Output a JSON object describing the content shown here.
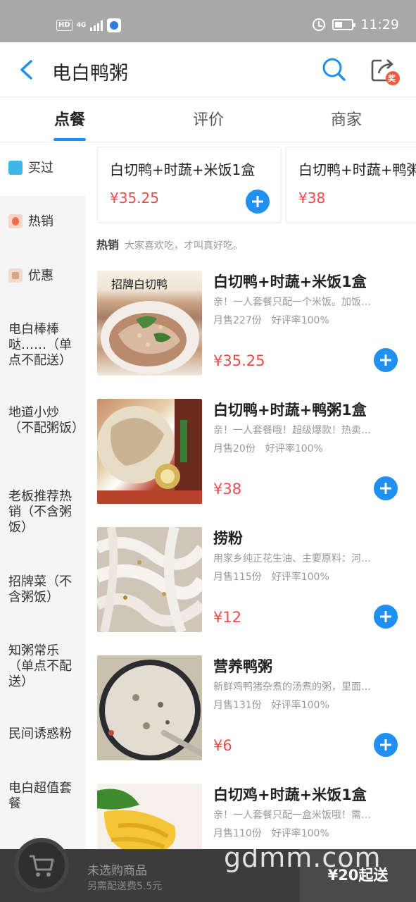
{
  "status_bar": {
    "hd": "HD",
    "network": "4G",
    "time": "11:29"
  },
  "header": {
    "title": "电白鸭粥",
    "back_icon": "chevron-left-icon",
    "search_icon": "search-icon",
    "share_icon": "share-icon",
    "share_badge": "奖"
  },
  "tabs": [
    {
      "label": "点餐"
    },
    {
      "label": "评价"
    },
    {
      "label": "商家"
    }
  ],
  "sidebar": {
    "items": [
      {
        "label": "买过",
        "icon": "bought-icon",
        "icon_color": "#3fb5e8"
      },
      {
        "label": "热销",
        "icon": "fire-icon",
        "icon_color": "#f38a6a"
      },
      {
        "label": "优惠",
        "icon": "discount-icon",
        "icon_color": "#e6b59a"
      },
      {
        "label": "电白棒棒哒……（单点不配送）"
      },
      {
        "label": "地道小炒（不配粥饭）"
      },
      {
        "label": "老板推荐热销（不含粥饭）"
      },
      {
        "label": "招牌菜（不含粥饭）"
      },
      {
        "label": "知粥常乐（单点不配送）"
      },
      {
        "label": "民间诱惑粉"
      },
      {
        "label": "电白超值套餐"
      }
    ]
  },
  "bought": [
    {
      "name": "白切鸭+时蔬+米饭1盒",
      "price": "¥35.25"
    },
    {
      "name": "白切鸭+时蔬+鸭粥1盒",
      "price": "¥38"
    }
  ],
  "section": {
    "title": "热销",
    "subtitle": "大家喜欢吃，才叫真好吃。"
  },
  "items": [
    {
      "name": "白切鸭+时蔬+米饭1盒",
      "desc": "亲！一人套餐只配一个米饭。加饭…",
      "sales": "月售227份",
      "rating": "好评率100%",
      "price": "¥35.25",
      "image_text": "招牌白切鸭"
    },
    {
      "name": "白切鸭+时蔬+鸭粥1盒",
      "desc": "亲！一人套餐哦！超级爆款！热卖…",
      "sales": "月售20份",
      "rating": "好评率100%",
      "price": "¥38"
    },
    {
      "name": "捞粉",
      "desc": "用家乡纯正花生油、主要原料：河…",
      "sales": "月售115份",
      "rating": "好评率100%",
      "price": "¥12"
    },
    {
      "name": "营养鸭粥",
      "desc": "新鲜鸡鸭猪杂煮的汤煮的粥，里面…",
      "sales": "月售131份",
      "rating": "好评率100%",
      "price": "¥6"
    },
    {
      "name": "白切鸡+时蔬+米饭1盒",
      "desc": "亲！一人套餐只配一盒米饭哦！需…",
      "sales": "月售110份",
      "rating": "好评率100%",
      "price": ""
    }
  ],
  "cart": {
    "empty_text": "未选购商品",
    "fee_text": "另需配送费5.5元",
    "min_order": "¥20起送",
    "icon": "cart-icon"
  },
  "watermark": "gdmm.com",
  "colors": {
    "accent": "#1f8ff1",
    "price": "#f04b4b",
    "cart_bar": "#3c3c3c"
  }
}
